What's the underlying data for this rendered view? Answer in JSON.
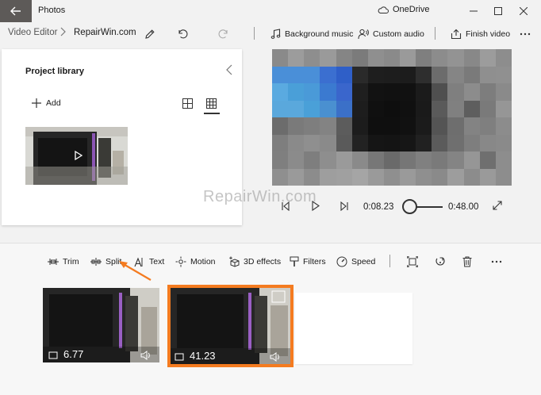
{
  "window": {
    "app_title": "Photos",
    "onedrive_label": "OneDrive"
  },
  "toolbar": {
    "breadcrumb_parent": "Video Editor",
    "project_name": "RepairWin.com",
    "background_music": "Background music",
    "custom_audio": "Custom audio",
    "finish_video": "Finish video"
  },
  "library": {
    "title": "Project library",
    "add_label": "Add"
  },
  "watermark": "RepairWin.com",
  "playback": {
    "current_time": "0:08.23",
    "total_time": "0:48.00",
    "position_fraction": 0.17
  },
  "storyboard": {
    "tools": [
      "Trim",
      "Split",
      "Text",
      "Motion",
      "3D effects",
      "Filters",
      "Speed"
    ],
    "clips": [
      {
        "duration": "6.77",
        "selected": false
      },
      {
        "duration": "41.23",
        "selected": true
      }
    ]
  },
  "colors": {
    "accent_selected": "#f47b20",
    "back_button": "#5d5a58",
    "annotation_arrow": "#f47b20"
  },
  "icons": {
    "back": "back-arrow-icon",
    "onedrive": "cloud-icon",
    "rename": "pencil-icon",
    "undo": "undo-icon",
    "redo": "redo-icon",
    "music": "music-note-icon",
    "audio": "person-audio-icon",
    "export": "export-icon",
    "more": "more-icon"
  }
}
